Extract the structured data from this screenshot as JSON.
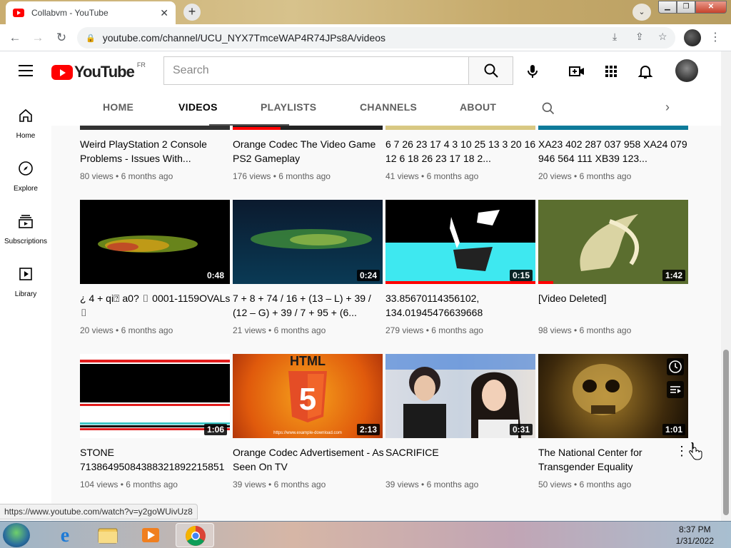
{
  "browser": {
    "tab_title": "Collabvm - YouTube",
    "new_tab": "+",
    "url": "youtube.com/channel/UCU_NYX7TmceWAP4R74JPs8A/videos",
    "status_url": "https://www.youtube.com/watch?v=y2goWUivUz8"
  },
  "youtube": {
    "logo_text": "YouTube",
    "region": "FR",
    "search_placeholder": "Search"
  },
  "sidebar": {
    "items": [
      {
        "label": "Home",
        "icon": "home-icon"
      },
      {
        "label": "Explore",
        "icon": "compass-icon"
      },
      {
        "label": "Subscriptions",
        "icon": "subscriptions-icon"
      },
      {
        "label": "Library",
        "icon": "library-icon"
      }
    ]
  },
  "channel_tabs": [
    "HOME",
    "VIDEOS",
    "PLAYLISTS",
    "CHANNELS",
    "ABOUT"
  ],
  "active_tab": "VIDEOS",
  "videos": [
    {
      "title": "Weird PlayStation 2 Console Problems - Issues With...",
      "views": "80 views",
      "age": "6 months ago",
      "duration": "",
      "progress": 0
    },
    {
      "title": "Orange Codec The Video Game PS2 Gameplay",
      "views": "176 views",
      "age": "6 months ago",
      "duration": "",
      "progress": 0.32
    },
    {
      "title": "6 7 26 23 17 4 3 10 25 13 3 20 16 12 6 18 26 23 17 18 2...",
      "views": "41 views",
      "age": "6 months ago",
      "duration": "",
      "progress": 0
    },
    {
      "title": "XA23 402 287 037 958 XA24 079 946 564 111 XB39 123...",
      "views": "20 views",
      "age": "6 months ago",
      "duration": "",
      "progress": 0
    },
    {
      "title": "¿ 4 + qi⍰ a0? ▯ 0001-1159OVALs ▯",
      "views": "20 views",
      "age": "6 months ago",
      "duration": "0:48",
      "progress": 0
    },
    {
      "title": "7 + 8 + 74 / 16 + (13 – L) + 39 / (12 – G) + 39 / 7 + 95 + (6...",
      "views": "21 views",
      "age": "6 months ago",
      "duration": "0:24",
      "progress": 0
    },
    {
      "title": "33.85670114356102, 134.01945476639668",
      "views": "279 views",
      "age": "6 months ago",
      "duration": "0:15",
      "progress": 1.0
    },
    {
      "title": "[Video Deleted]",
      "views": "98 views",
      "age": "6 months ago",
      "duration": "1:42",
      "progress": 0.1
    },
    {
      "title": "STONE 71386495084388321892215851",
      "views": "104 views",
      "age": "6 months ago",
      "duration": "1:06",
      "progress": 0
    },
    {
      "title": "Orange Codec Advertisement - As Seen On TV",
      "views": "39 views",
      "age": "6 months ago",
      "duration": "2:13",
      "progress": 0
    },
    {
      "title": "SACRIFICE",
      "views": "39 views",
      "age": "6 months ago",
      "duration": "0:31",
      "progress": 0
    },
    {
      "title": "The National Center for Transgender Equality",
      "views": "50 views",
      "age": "6 months ago",
      "duration": "1:01",
      "progress": 0
    }
  ],
  "thumb_text": {
    "html_label": "HTML",
    "html_number": "5",
    "watermark": "https://www.example-download.com"
  },
  "taskbar": {
    "time": "8:37 PM",
    "date": "1/31/2022"
  },
  "colors": {
    "brand_red": "#ff0000",
    "accent": "#065fd4"
  }
}
